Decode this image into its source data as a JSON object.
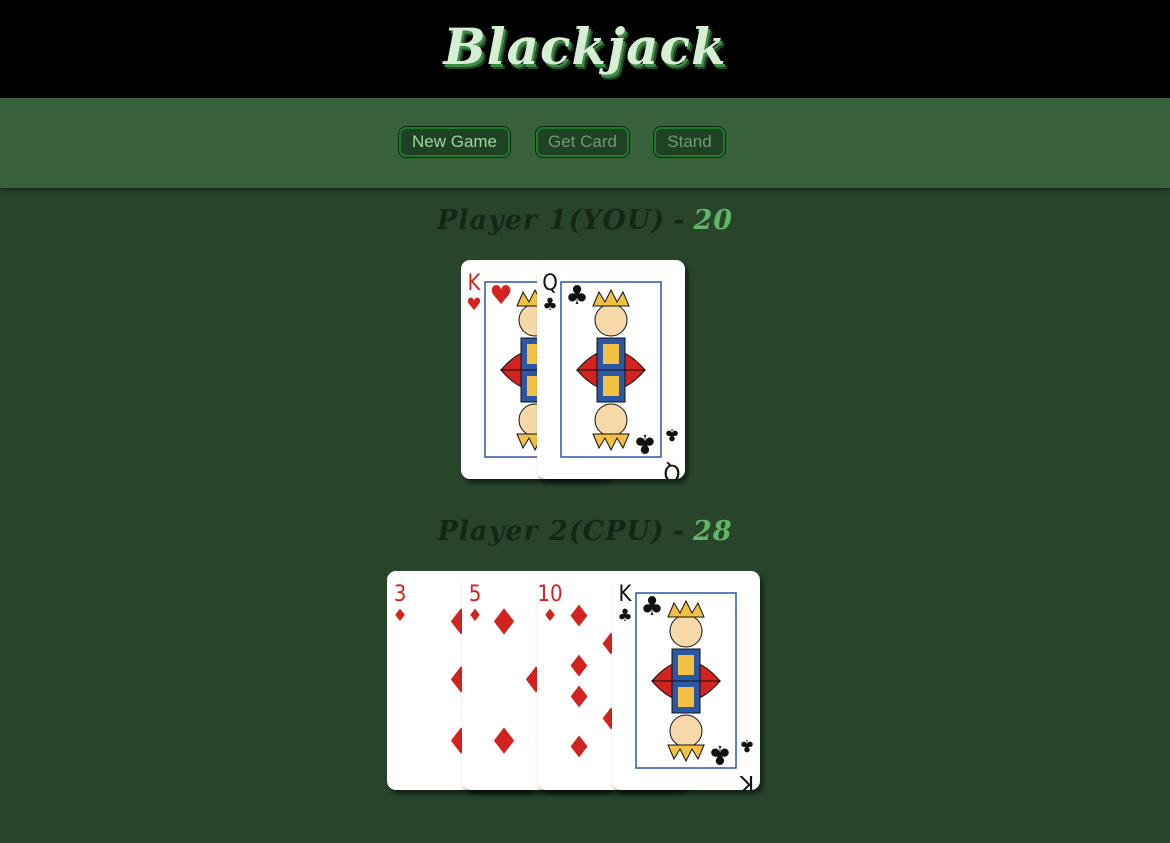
{
  "header": {
    "title": "Blackjack"
  },
  "controls": {
    "new_game_label": "New Game",
    "get_card_label": "Get Card",
    "stand_label": "Stand"
  },
  "player1": {
    "label": "Player 1(YOU)",
    "separator": "-",
    "score": "20",
    "cards": [
      {
        "rank": "K",
        "suit": "hearts",
        "suit_symbol": "♥",
        "color": "#d3231f"
      },
      {
        "rank": "Q",
        "suit": "clubs",
        "suit_symbol": "♣",
        "color": "#111111"
      }
    ]
  },
  "player2": {
    "label": "Player 2(CPU)",
    "separator": "-",
    "score": "28",
    "cards": [
      {
        "rank": "3",
        "suit": "diamonds",
        "suit_symbol": "♦",
        "color": "#d3231f"
      },
      {
        "rank": "5",
        "suit": "diamonds",
        "suit_symbol": "♦",
        "color": "#d3231f"
      },
      {
        "rank": "10",
        "suit": "diamonds",
        "suit_symbol": "♦",
        "color": "#d3231f"
      },
      {
        "rank": "K",
        "suit": "clubs",
        "suit_symbol": "♣",
        "color": "#111111"
      }
    ]
  },
  "colors": {
    "table": "#28452c",
    "toolbar": "#376239",
    "accent": "#5fb766"
  }
}
